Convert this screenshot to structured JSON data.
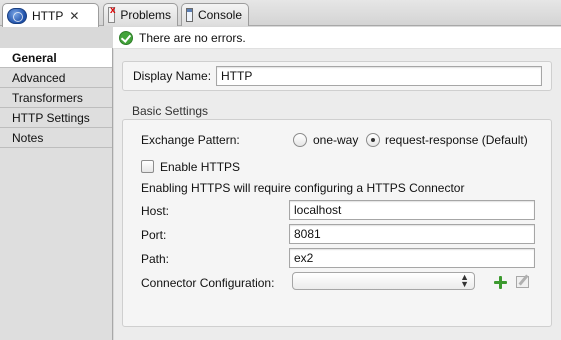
{
  "tabs": [
    {
      "label": "HTTP",
      "icon": "globe-icon",
      "active": true,
      "closable": true
    },
    {
      "label": "Problems",
      "icon": "problems-icon",
      "active": false
    },
    {
      "label": "Console",
      "icon": "console-icon",
      "active": false
    }
  ],
  "status": {
    "message": "There are no errors.",
    "icon": "check-circle-icon"
  },
  "sidebar": {
    "items": [
      {
        "label": "General",
        "selected": true
      },
      {
        "label": "Advanced"
      },
      {
        "label": "Transformers"
      },
      {
        "label": "HTTP Settings"
      },
      {
        "label": "Notes"
      }
    ]
  },
  "general": {
    "display_name_label": "Display Name:",
    "display_name_value": "HTTP",
    "section_title": "Basic Settings",
    "exchange_pattern_label": "Exchange Pattern:",
    "exchange_options": [
      {
        "label": "one-way",
        "selected": false
      },
      {
        "label": "request-response (Default)",
        "selected": true
      }
    ],
    "enable_https_label": "Enable HTTPS",
    "enable_https_checked": false,
    "https_note": "Enabling HTTPS will require configuring a HTTPS Connector",
    "host_label": "Host:",
    "host_value": "localhost",
    "port_label": "Port:",
    "port_value": "8081",
    "path_label": "Path:",
    "path_value": "ex2",
    "connector_label": "Connector Configuration:",
    "connector_value": ""
  },
  "colors": {
    "accent_green": "#3c9a2f",
    "status_ok": "#42a33a"
  }
}
